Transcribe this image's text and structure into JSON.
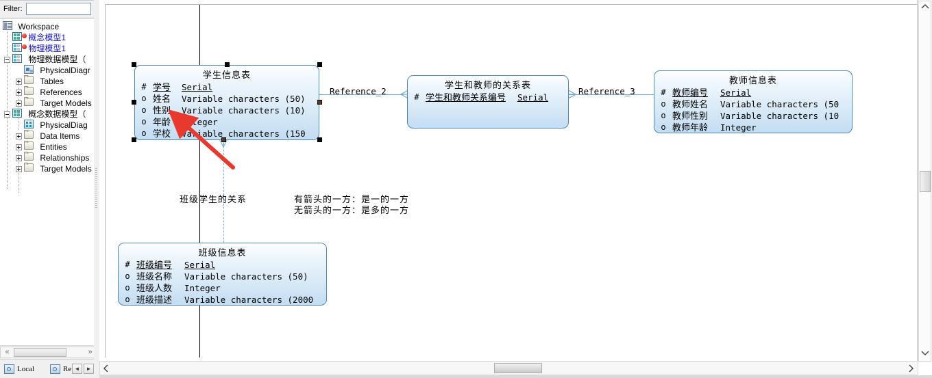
{
  "app": {
    "tool": "PowerDesigner",
    "filter_label": "Filter:",
    "filter_value": ""
  },
  "sidebar": {
    "root": {
      "label": "Workspace",
      "icon": "workspace-icon"
    },
    "items": [
      {
        "label": "概念模型1",
        "icon": "cdm-icon",
        "indent": 2,
        "color": "#1414c8",
        "badge": "red-dot",
        "expander": "none"
      },
      {
        "label": "物理模型1",
        "icon": "pdm-icon",
        "indent": 2,
        "color": "#1414c8",
        "badge": "red-dot",
        "expander": "none"
      },
      {
        "label": "物理数据模型（",
        "icon": "pdm-icon",
        "indent": 2,
        "color": "#000000",
        "badge": "none",
        "expander": "minus"
      },
      {
        "label": "PhysicalDiagr",
        "icon": "diagram-icon",
        "indent": 3,
        "color": "#000000",
        "badge": "none",
        "expander": "none"
      },
      {
        "label": "Tables",
        "icon": "folder-icon",
        "indent": 3,
        "color": "#000000",
        "badge": "none",
        "expander": "plus"
      },
      {
        "label": "References",
        "icon": "folder-icon",
        "indent": 3,
        "color": "#000000",
        "badge": "none",
        "expander": "plus"
      },
      {
        "label": "Target Models",
        "icon": "folder-icon",
        "indent": 3,
        "color": "#000000",
        "badge": "none",
        "expander": "plus"
      },
      {
        "label": "概念数据模型（",
        "icon": "cdm-icon",
        "indent": 2,
        "color": "#000000",
        "badge": "none",
        "expander": "minus"
      },
      {
        "label": "PhysicalDiag",
        "icon": "diagram2-icon",
        "indent": 3,
        "color": "#000000",
        "badge": "none",
        "expander": "none"
      },
      {
        "label": "Data Items",
        "icon": "folder-icon",
        "indent": 3,
        "color": "#000000",
        "badge": "none",
        "expander": "plus"
      },
      {
        "label": "Entities",
        "icon": "folder-icon",
        "indent": 3,
        "color": "#000000",
        "badge": "none",
        "expander": "plus"
      },
      {
        "label": "Relationships",
        "icon": "folder-icon",
        "indent": 3,
        "color": "#000000",
        "badge": "none",
        "expander": "plus"
      },
      {
        "label": "Target Models",
        "icon": "folder-icon",
        "indent": 3,
        "color": "#000000",
        "badge": "none",
        "expander": "plus"
      }
    ],
    "tabs": [
      {
        "label": "Local",
        "icon": "local-model-icon"
      },
      {
        "label": "Re",
        "icon": "repository-icon"
      }
    ],
    "tab_prev": "◄",
    "tab_next": "►",
    "hscroll_left": "«",
    "hscroll_right": "»"
  },
  "canvas": {
    "entities": [
      {
        "id": "student",
        "title": "学生信息表",
        "selected": true,
        "attributes": [
          {
            "key": "#",
            "name": "学号",
            "type": "Serial",
            "pk": true
          },
          {
            "key": "o",
            "name": "姓名",
            "type": "Variable characters (50)",
            "pk": false
          },
          {
            "key": "o",
            "name": "性别",
            "type": "Variable characters (10)",
            "pk": false
          },
          {
            "key": "o",
            "name": "年龄",
            "type": "Integer",
            "pk": false
          },
          {
            "key": "o",
            "name": "学校",
            "type": "Variable characters (150",
            "pk": false
          }
        ]
      },
      {
        "id": "student-teacher",
        "title": "学生和教师的关系表",
        "selected": false,
        "attributes": [
          {
            "key": "#",
            "name": "学生和教师关系编号",
            "type": "Serial",
            "pk": true
          }
        ]
      },
      {
        "id": "teacher",
        "title": "教师信息表",
        "selected": false,
        "attributes": [
          {
            "key": "#",
            "name": "教师编号",
            "type": "Serial",
            "pk": true
          },
          {
            "key": "o",
            "name": "教师姓名",
            "type": "Variable characters (50",
            "pk": false
          },
          {
            "key": "o",
            "name": "教师性别",
            "type": "Variable characters (10",
            "pk": false
          },
          {
            "key": "o",
            "name": "教师年龄",
            "type": "Integer",
            "pk": false
          }
        ]
      },
      {
        "id": "class",
        "title": "班级信息表",
        "selected": false,
        "attributes": [
          {
            "key": "#",
            "name": "班级编号",
            "type": "Serial",
            "pk": true
          },
          {
            "key": "o",
            "name": "班级名称",
            "type": "Variable characters (50)",
            "pk": false
          },
          {
            "key": "o",
            "name": "班级人数",
            "type": "Integer",
            "pk": false
          },
          {
            "key": "o",
            "name": "班级描述",
            "type": "Variable characters (2000",
            "pk": false
          }
        ]
      }
    ],
    "links": [
      {
        "id": "ref2",
        "label": "Reference_2"
      },
      {
        "id": "ref3",
        "label": "Reference_3"
      }
    ],
    "notes": [
      {
        "id": "class-student-rel",
        "text": "班级学生的关系"
      },
      {
        "id": "legend-line-1",
        "text": "有箭头的一方：是一的一方"
      },
      {
        "id": "legend-line-2",
        "text": "无箭头的一方：是多的一方"
      }
    ],
    "colors": {
      "entity_border": "#4a89b8",
      "entity_fill_top": "#fdfeff",
      "entity_fill_bottom": "#c3ddf2",
      "link": "#6aa9cf",
      "annotation_arrow": "#e8392e",
      "tree_model_text": "#1414c8"
    }
  }
}
